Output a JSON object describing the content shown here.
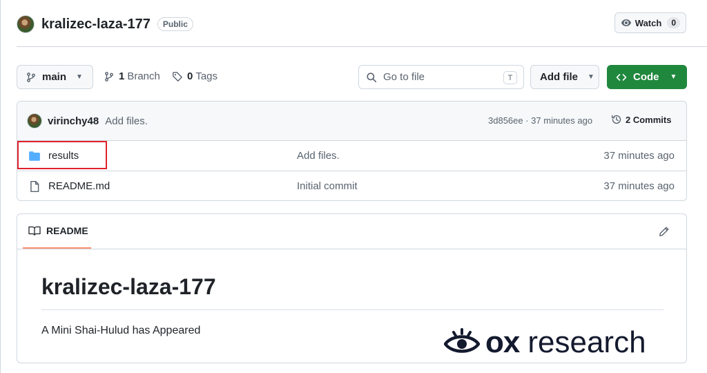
{
  "repo": {
    "name": "kralizec-laza-177",
    "visibility": "Public",
    "watch_label": "Watch",
    "watch_count": "0"
  },
  "toolbar": {
    "branch": "main",
    "branch_count": "1",
    "branch_label": "Branch",
    "tag_count": "0",
    "tag_label": "Tags",
    "search_placeholder": "Go to file",
    "search_shortcut": "T",
    "add_file_label": "Add file",
    "code_label": "Code"
  },
  "latest_commit": {
    "author": "virinchy48",
    "message": "Add files.",
    "meta": "3d856ee · 37 minutes ago",
    "commits_label": "2 Commits"
  },
  "files": [
    {
      "name": "results",
      "type": "folder",
      "commit": "Add files.",
      "time": "37 minutes ago",
      "icon": "folder-icon"
    },
    {
      "name": "README.md",
      "type": "file",
      "commit": "Initial commit",
      "time": "37 minutes ago",
      "icon": "file-icon"
    }
  ],
  "readme": {
    "tab_label": "README",
    "title": "kralizec-laza-177",
    "body": "A Mini Shai-Hulud has Appeared"
  },
  "watermark": {
    "brand": "ox",
    "suffix": "research"
  },
  "colors": {
    "primary_button": "#1f883d",
    "highlight_box": "#e0202a",
    "folder": "#54aeff",
    "tab_underline": "#fd8c73"
  }
}
